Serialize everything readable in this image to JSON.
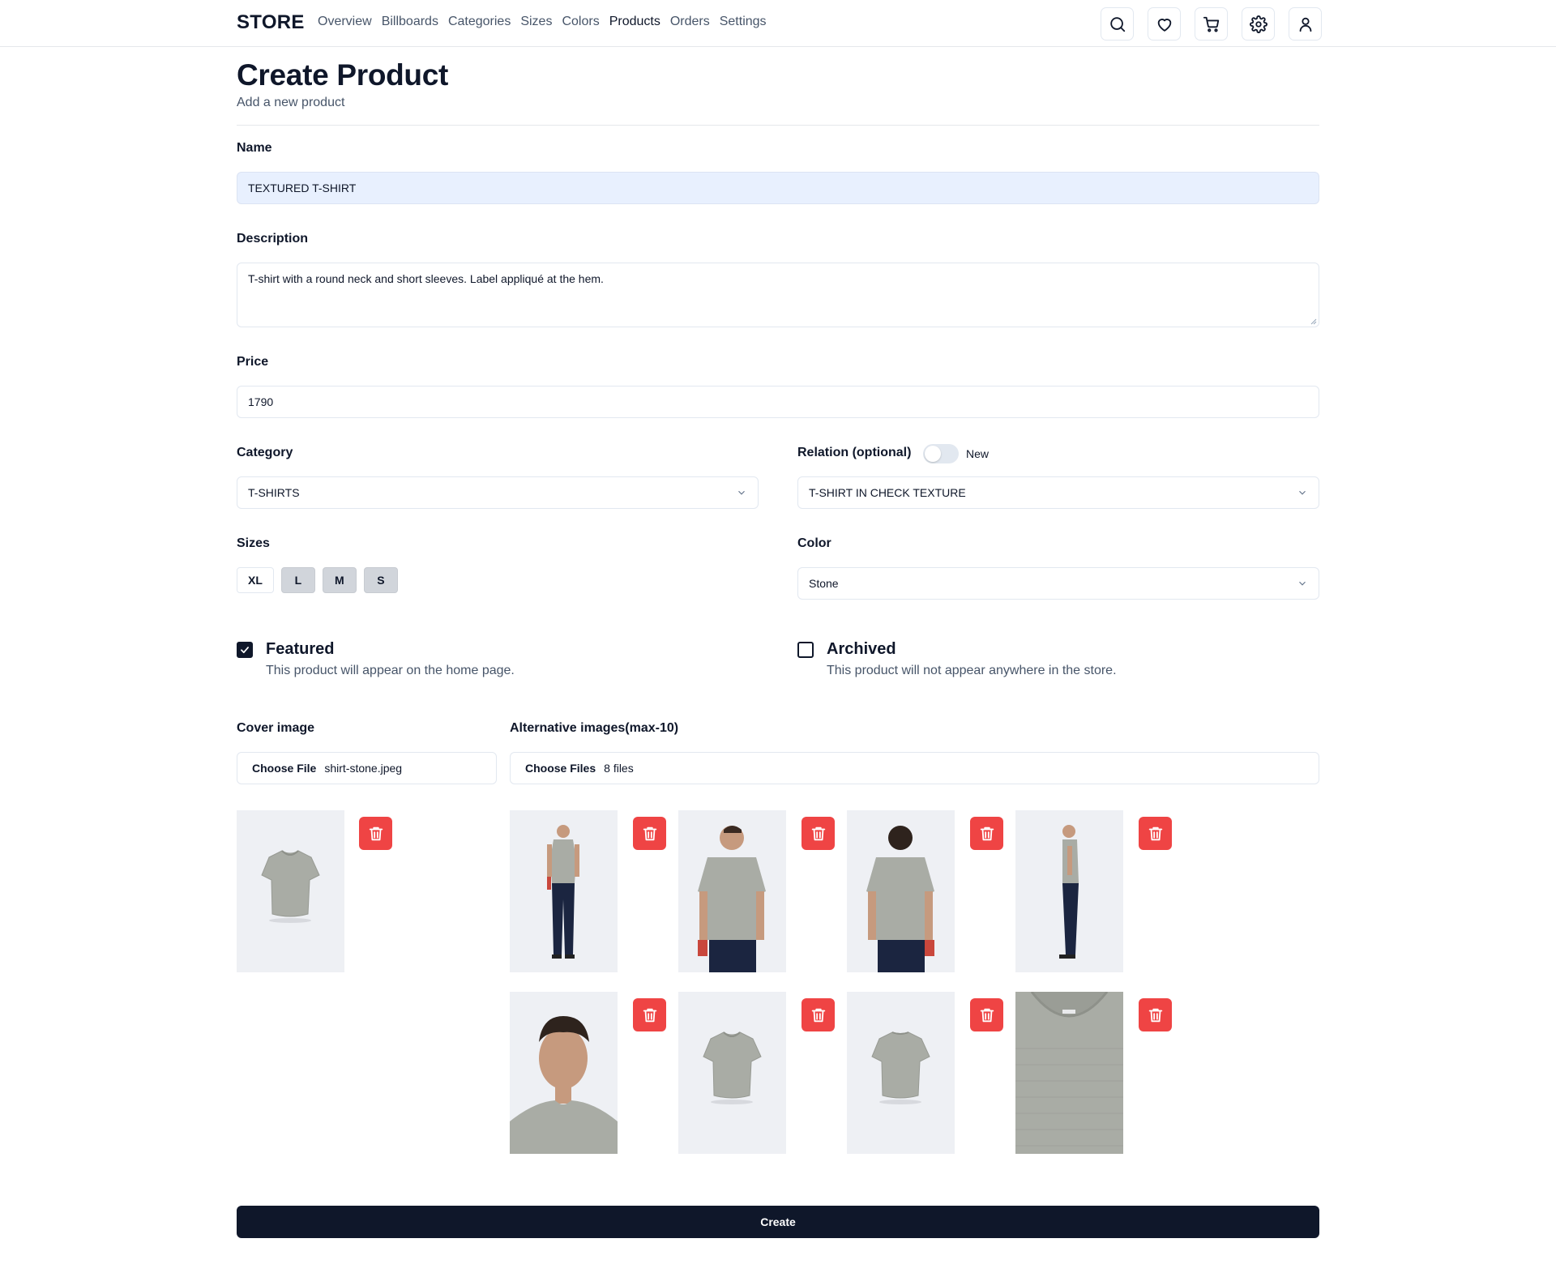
{
  "nav": {
    "brand": "STORE",
    "links": [
      {
        "label": "Overview",
        "active": false
      },
      {
        "label": "Billboards",
        "active": false
      },
      {
        "label": "Categories",
        "active": false
      },
      {
        "label": "Sizes",
        "active": false
      },
      {
        "label": "Colors",
        "active": false
      },
      {
        "label": "Products",
        "active": true
      },
      {
        "label": "Orders",
        "active": false
      },
      {
        "label": "Settings",
        "active": false
      }
    ],
    "icons": [
      "search-icon",
      "heart-icon",
      "cart-icon",
      "gear-icon",
      "user-icon"
    ]
  },
  "header": {
    "title": "Create Product",
    "subtitle": "Add a new product"
  },
  "form": {
    "name": {
      "label": "Name",
      "value": "TEXTURED T-SHIRT"
    },
    "description": {
      "label": "Description",
      "value": "T-shirt with a round neck and short sleeves. Label appliqué at the hem."
    },
    "price": {
      "label": "Price",
      "value": "1790"
    },
    "category": {
      "label": "Category",
      "value": "T-SHIRTS"
    },
    "relation": {
      "label": "Relation (optional)",
      "toggle_label": "New",
      "toggle_on": false,
      "value": "T-SHIRT IN CHECK TEXTURE"
    },
    "sizes": {
      "label": "Sizes",
      "options": [
        {
          "label": "XL",
          "selected": false
        },
        {
          "label": "L",
          "selected": true
        },
        {
          "label": "M",
          "selected": true
        },
        {
          "label": "S",
          "selected": true
        }
      ]
    },
    "color": {
      "label": "Color",
      "value": "Stone"
    },
    "featured": {
      "label": "Featured",
      "description": "This product will appear on the home page.",
      "checked": true
    },
    "archived": {
      "label": "Archived",
      "description": "This product will not appear anywhere in the store.",
      "checked": false
    },
    "cover_image": {
      "label": "Cover image",
      "button": "Choose File",
      "file": "shirt-stone.jpeg"
    },
    "alt_images": {
      "label": "Alternative images(max-10)",
      "button": "Choose Files",
      "file": "8 files"
    },
    "submit": "Create"
  },
  "colors": {
    "primary": "#0f172a",
    "danger": "#ef4444",
    "autofill": "#e8f0fe",
    "shirt": "#a9aca5",
    "pants": "#1b2540"
  }
}
